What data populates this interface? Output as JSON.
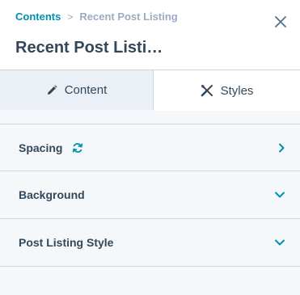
{
  "breadcrumb": {
    "parent": "Contents",
    "separator": ">",
    "current": "Recent Post Listing"
  },
  "panel": {
    "title": "Recent Post Listi…"
  },
  "tabs": [
    {
      "label": "Content",
      "icon": "pencil-icon",
      "active": false
    },
    {
      "label": "Styles",
      "icon": "styles-icon",
      "active": true
    }
  ],
  "sections": [
    {
      "label": "Spacing",
      "extra_icon": "sync-icon",
      "caret": "chevron-right-icon"
    },
    {
      "label": "Background",
      "caret": "chevron-down-icon"
    },
    {
      "label": "Post Listing Style",
      "caret": "chevron-down-icon"
    }
  ],
  "colors": {
    "accent": "#0091ae",
    "text": "#33475b",
    "muted": "#99acc2",
    "border": "#cbd6e2",
    "panel_bg": "#f5f8fa"
  }
}
